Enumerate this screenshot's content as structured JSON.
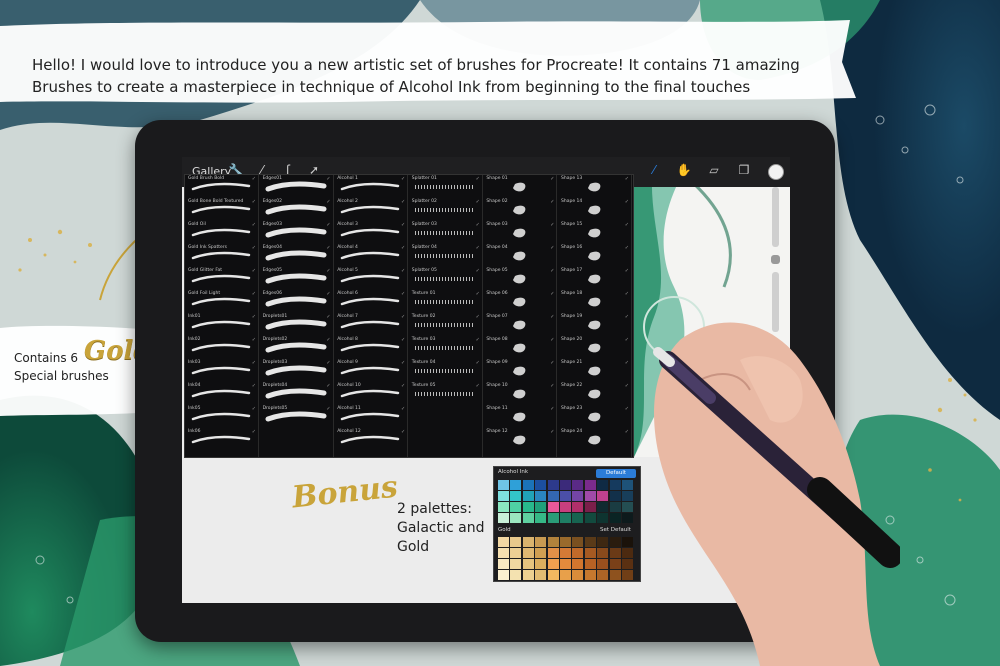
{
  "banner": {
    "line1": "Hello! I would love to introduce you a new artistic set of brushes for Procreate! It contains 71 amazing",
    "line2": "Brushes to create a masterpiece in technique of Alcohol Ink from beginning to the final touches"
  },
  "side_label": {
    "line1": "Contains 6",
    "gold_word": "Gold",
    "line2": "Special brushes"
  },
  "toolbar": {
    "gallery_label": "Gallery",
    "left_icons": [
      "wrench-icon",
      "wand-icon",
      "s-select-icon",
      "arrow-icon"
    ],
    "right_icons": [
      "brush-icon",
      "smudge-icon",
      "eraser-icon",
      "layers-icon",
      "color-icon"
    ],
    "accent": "#2b7cd8"
  },
  "brushes": {
    "columns": [
      [
        "Gold Brush Bold",
        "Gold Bone Bold Textured",
        "Gold Oil",
        "Gold Ink Spatters",
        "Gold Glitter Fat",
        "Gold Foil Light",
        "Ink01",
        "Ink02",
        "Ink03",
        "Ink04",
        "Ink05",
        "Ink06"
      ],
      [
        "Edges01",
        "Edges02",
        "Edges03",
        "Edges04",
        "Edges05",
        "Edges06",
        "Droplets01",
        "Droplets02",
        "Droplets03",
        "Droplets04",
        "Droplets05",
        ""
      ],
      [
        "Alcohol 1",
        "Alcohol 2",
        "Alcohol 3",
        "Alcohol 4",
        "Alcohol 5",
        "Alcohol 6",
        "Alcohol 7",
        "Alcohol 8",
        "Alcohol 9",
        "Alcohol 10",
        "Alcohol 11",
        "Alcohol 12"
      ],
      [
        "Splatter 01",
        "Splatter 02",
        "Splatter 03",
        "Splatter 04",
        "Splatter 05",
        "Texture 01",
        "Texture 02",
        "Texture 03",
        "Texture 04",
        "Texture 05",
        "",
        ""
      ],
      [
        "Shape 01",
        "Shape 02",
        "Shape 03",
        "Shape 04",
        "Shape 05",
        "Shape 06",
        "Shape 07",
        "Shape 08",
        "Shape 09",
        "Shape 10",
        "Shape 11",
        "Shape 12"
      ],
      [
        "Shape 13",
        "Shape 14",
        "Shape 15",
        "Shape 16",
        "Shape 17",
        "Shape 18",
        "Shape 19",
        "Shape 20",
        "Shape 21",
        "Shape 22",
        "Shape 23",
        "Shape 24"
      ]
    ]
  },
  "bonus": {
    "word": "Bonus",
    "palettes_line1": "2 palettes:",
    "palettes_line2": "Galactic and",
    "palettes_line3": "Gold"
  },
  "palette_widget": {
    "palette1_name": "Alcohol Ink",
    "default_label": "Default",
    "palette2_name": "Gold",
    "set_default_label": "Set Default",
    "palette1_colors": [
      "#6fc4e6",
      "#2fa0d8",
      "#1b73b8",
      "#1c4fa0",
      "#2d3a8c",
      "#3b2a7a",
      "#5a2a86",
      "#7a2b8c",
      "#0f2a44",
      "#153a5e",
      "#1e5278",
      "#7ee0e0",
      "#33c6c9",
      "#21a3b8",
      "#2a86c0",
      "#3367b2",
      "#4b4fa8",
      "#7345a6",
      "#a04aa8",
      "#c0418e",
      "#12304a",
      "#183e5a",
      "#8ae8c0",
      "#4fd1a4",
      "#28b98c",
      "#1fa07a",
      "#e8589a",
      "#c93f7e",
      "#b02f6a",
      "#7a1f4a",
      "#102a30",
      "#1a3c42",
      "#244e52",
      "#c8f0d8",
      "#9be6bf",
      "#5fd0a0",
      "#36b887",
      "#2a9c78",
      "#1f7e64",
      "#176450",
      "#124a3e",
      "#0e3430",
      "#0a2424",
      "#0d1a1c"
    ],
    "palette2_colors": [
      "#f2d8a4",
      "#e8c98c",
      "#d9b36e",
      "#c89a52",
      "#b2823c",
      "#9a6a2c",
      "#7a5020",
      "#5a3a18",
      "#3e2812",
      "#2a1c0e",
      "#1a120a",
      "#f6e0b0",
      "#eccf94",
      "#dfb872",
      "#d09f52",
      "#e39048",
      "#d47a36",
      "#c06a2a",
      "#a65a22",
      "#884a1c",
      "#6a3a16",
      "#4c2a10",
      "#f8e8c0",
      "#f0d8a0",
      "#e6c47e",
      "#dbae5e",
      "#f0a050",
      "#e48a3c",
      "#d2762e",
      "#b86224",
      "#9a501e",
      "#7a4018",
      "#5a3012",
      "#fbf0d0",
      "#f4e2b0",
      "#ecd090",
      "#e2bc72",
      "#f2b860",
      "#e8a04a",
      "#da8c3a",
      "#c6782e",
      "#ac6426",
      "#8e521e",
      "#703e16"
    ]
  }
}
